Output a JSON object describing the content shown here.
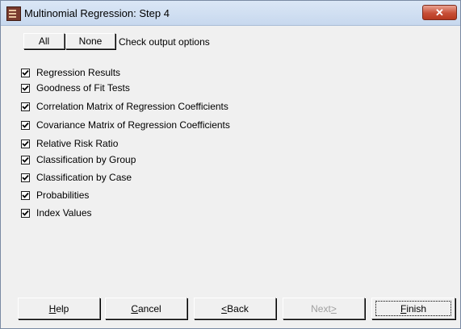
{
  "window": {
    "title": "Multinomial Regression: Step 4",
    "close_glyph": "✕",
    "app_icon": "table-icon"
  },
  "selection": {
    "all_label": "All",
    "none_label": "None",
    "hint": "Check output options"
  },
  "options": [
    {
      "label": "Regression Results",
      "checked": true
    },
    {
      "label": "Goodness of Fit Tests",
      "checked": true
    },
    {
      "label": "Correlation Matrix of Regression Coefficients",
      "checked": true
    },
    {
      "label": "Covariance Matrix of Regression Coefficients",
      "checked": true
    },
    {
      "label": "Relative Risk Ratio",
      "checked": true
    },
    {
      "label": "Classification by Group",
      "checked": true
    },
    {
      "label": "Classification by Case",
      "checked": true
    },
    {
      "label": "Probabilities",
      "checked": true
    },
    {
      "label": "Index Values",
      "checked": true
    }
  ],
  "footer": {
    "help": {
      "label": "Help",
      "mnemonic": "H",
      "rest": "elp"
    },
    "cancel": {
      "label": "Cancel",
      "mnemonic": "C",
      "rest": "ancel"
    },
    "back": {
      "label": "< Back",
      "mnemonic": "<",
      "rest": " Back"
    },
    "next": {
      "label": "Next >",
      "text": "Next ",
      "mnemonic": ">",
      "enabled": false
    },
    "finish": {
      "label": "Finish",
      "mnemonic": "F",
      "rest": "inish",
      "default": true
    }
  }
}
